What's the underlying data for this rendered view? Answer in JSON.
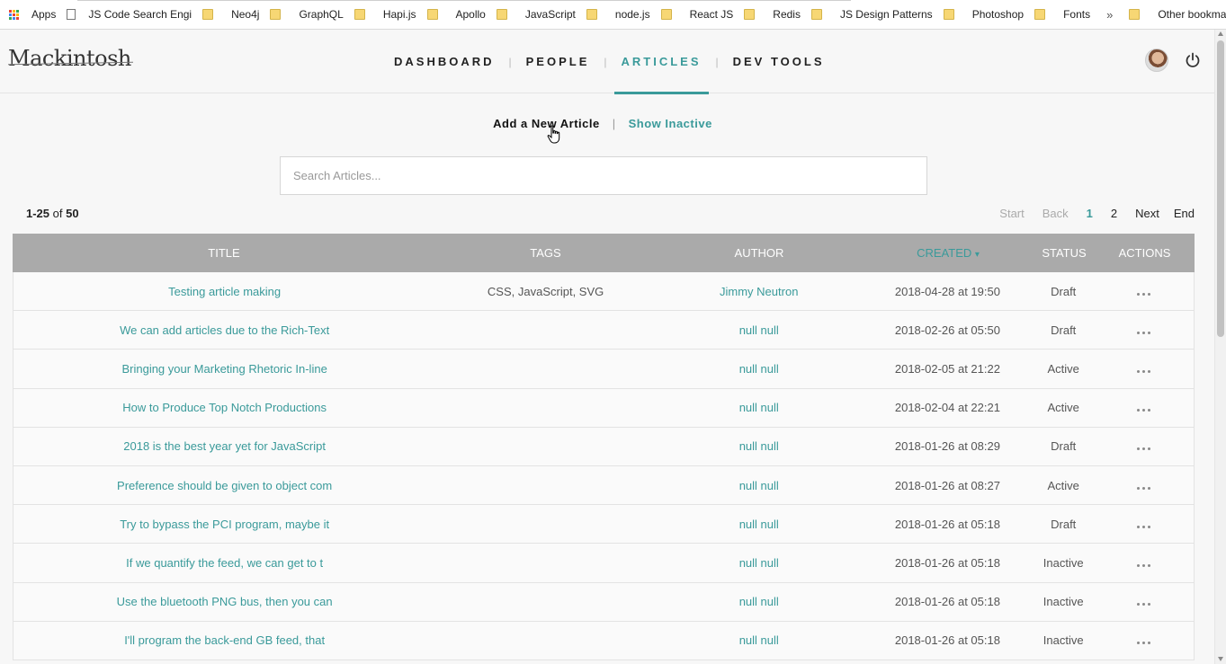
{
  "bookmarks": {
    "apps_label": "Apps",
    "items": [
      {
        "label": "JS Code Search Engi",
        "kind": "page"
      },
      {
        "label": "Neo4j",
        "kind": "folder"
      },
      {
        "label": "GraphQL",
        "kind": "folder"
      },
      {
        "label": "Hapi.js",
        "kind": "folder"
      },
      {
        "label": "Apollo",
        "kind": "folder"
      },
      {
        "label": "JavaScript",
        "kind": "folder"
      },
      {
        "label": "node.js",
        "kind": "folder"
      },
      {
        "label": "React JS",
        "kind": "folder"
      },
      {
        "label": "Redis",
        "kind": "folder"
      },
      {
        "label": "JS Design Patterns",
        "kind": "folder"
      },
      {
        "label": "Photoshop",
        "kind": "folder"
      },
      {
        "label": "Fonts",
        "kind": "folder"
      }
    ],
    "more_label": "»",
    "other_label": "Other bookmarks"
  },
  "header": {
    "logo": "Mackintosh",
    "nav": [
      {
        "label": "DASHBOARD",
        "active": false
      },
      {
        "label": "PEOPLE",
        "active": false
      },
      {
        "label": "ARTICLES",
        "active": true
      },
      {
        "label": "DEV TOOLS",
        "active": false
      }
    ],
    "nav_separator": "|"
  },
  "actions": {
    "add_label": "Add a New Article",
    "separator": "|",
    "show_inactive_label": "Show Inactive"
  },
  "search": {
    "placeholder": "Search Articles...",
    "value": ""
  },
  "results": {
    "range": "1-25",
    "of_label": "of",
    "total": "50"
  },
  "pagination": {
    "start": "Start",
    "back": "Back",
    "pages": [
      "1",
      "2"
    ],
    "current": "1",
    "next": "Next",
    "end": "End"
  },
  "table": {
    "columns": [
      "TITLE",
      "TAGS",
      "AUTHOR",
      "CREATED",
      "STATUS",
      "ACTIONS"
    ],
    "sort_indicator": "▾",
    "sorted_column": "CREATED",
    "rows": [
      {
        "title": "Testing article making",
        "tags": "CSS, JavaScript, SVG",
        "author": "Jimmy Neutron",
        "created": "2018-04-28 at 19:50",
        "status": "Draft"
      },
      {
        "title": "We can add articles due to the Rich-Text",
        "tags": "",
        "author": "null null",
        "created": "2018-02-26 at 05:50",
        "status": "Draft"
      },
      {
        "title": "Bringing your Marketing Rhetoric In-line",
        "tags": "",
        "author": "null null",
        "created": "2018-02-05 at 21:22",
        "status": "Active"
      },
      {
        "title": "How to Produce Top Notch Productions",
        "tags": "",
        "author": "null null",
        "created": "2018-02-04 at 22:21",
        "status": "Active"
      },
      {
        "title": "2018 is the best year yet for JavaScript",
        "tags": "",
        "author": "null null",
        "created": "2018-01-26 at 08:29",
        "status": "Draft"
      },
      {
        "title": "Preference should be given to object com",
        "tags": "",
        "author": "null null",
        "created": "2018-01-26 at 08:27",
        "status": "Active"
      },
      {
        "title": "Try to bypass the PCI program, maybe it",
        "tags": "",
        "author": "null null",
        "created": "2018-01-26 at 05:18",
        "status": "Draft"
      },
      {
        "title": "If we quantify the feed, we can get to t",
        "tags": "",
        "author": "null null",
        "created": "2018-01-26 at 05:18",
        "status": "Inactive"
      },
      {
        "title": "Use the bluetooth PNG bus, then you can",
        "tags": "",
        "author": "null null",
        "created": "2018-01-26 at 05:18",
        "status": "Inactive"
      },
      {
        "title": "I'll program the back-end GB feed, that",
        "tags": "",
        "author": "null null",
        "created": "2018-01-26 at 05:18",
        "status": "Inactive"
      }
    ]
  },
  "colors": {
    "accent": "#3a9a9a",
    "table_header": "#aaaaaa",
    "background": "#f7f7f7"
  }
}
